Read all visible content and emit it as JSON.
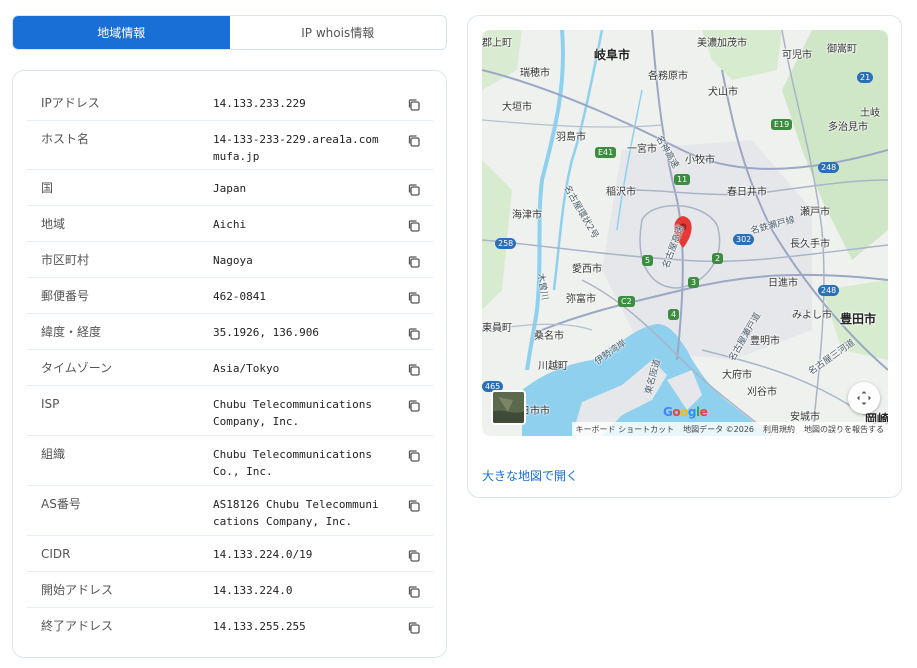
{
  "tabs": [
    {
      "label": "地域情報",
      "active": true
    },
    {
      "label": "IP whois情報",
      "active": false
    }
  ],
  "info_rows": [
    {
      "label": "IPアドレス",
      "value": "14.133.233.229"
    },
    {
      "label": "ホスト名",
      "value": "14-133-233-229.area1a.commufa.jp"
    },
    {
      "label": "国",
      "value": "Japan"
    },
    {
      "label": "地域",
      "value": "Aichi"
    },
    {
      "label": "市区町村",
      "value": "Nagoya"
    },
    {
      "label": "郵便番号",
      "value": "462-0841"
    },
    {
      "label": "緯度・経度",
      "value": "35.1926, 136.906"
    },
    {
      "label": "タイムゾーン",
      "value": "Asia/Tokyo"
    },
    {
      "label": "ISP",
      "value": "Chubu Telecommunications Company, Inc."
    },
    {
      "label": "組織",
      "value": "Chubu Telecommunications Co., Inc."
    },
    {
      "label": "AS番号",
      "value": "AS18126 Chubu Telecommunications Company, Inc."
    },
    {
      "label": "CIDR",
      "value": "14.133.224.0/19"
    },
    {
      "label": "開始アドレス",
      "value": "14.133.224.0"
    },
    {
      "label": "終了アドレス",
      "value": "14.133.255.255"
    }
  ],
  "map": {
    "places": [
      {
        "name": "郡上町",
        "cls": ""
      },
      {
        "name": "岐阜市",
        "cls": "big"
      },
      {
        "name": "美濃加茂市",
        "cls": ""
      },
      {
        "name": "可児市",
        "cls": ""
      },
      {
        "name": "御嵩町",
        "cls": ""
      },
      {
        "name": "瑞穂市",
        "cls": ""
      },
      {
        "name": "各務原市",
        "cls": ""
      },
      {
        "name": "犬山市",
        "cls": ""
      },
      {
        "name": "大垣市",
        "cls": ""
      },
      {
        "name": "土岐",
        "cls": ""
      },
      {
        "name": "多治見市",
        "cls": ""
      },
      {
        "name": "羽島市",
        "cls": ""
      },
      {
        "name": "一宮市",
        "cls": ""
      },
      {
        "name": "小牧市",
        "cls": ""
      },
      {
        "name": "稲沢市",
        "cls": ""
      },
      {
        "name": "春日井市",
        "cls": ""
      },
      {
        "name": "海津市",
        "cls": ""
      },
      {
        "name": "瀬戸市",
        "cls": ""
      },
      {
        "name": "長久手市",
        "cls": ""
      },
      {
        "name": "愛西市",
        "cls": ""
      },
      {
        "name": "日進市",
        "cls": ""
      },
      {
        "name": "弥富市",
        "cls": ""
      },
      {
        "name": "みよし市",
        "cls": ""
      },
      {
        "name": "豊田市",
        "cls": "big"
      },
      {
        "name": "東員町",
        "cls": ""
      },
      {
        "name": "桑名市",
        "cls": ""
      },
      {
        "name": "豊明市",
        "cls": ""
      },
      {
        "name": "川越町",
        "cls": ""
      },
      {
        "name": "大府市",
        "cls": ""
      },
      {
        "name": "刈谷市",
        "cls": ""
      },
      {
        "name": "安城市",
        "cls": ""
      },
      {
        "name": "岡崎",
        "cls": "big"
      },
      {
        "name": "日市市",
        "cls": ""
      }
    ],
    "roads": [
      {
        "name": "名神高速",
        "rot": "60"
      },
      {
        "name": "名古屋高速",
        "rot": "-70"
      },
      {
        "name": "東名阪道",
        "rot": "-75"
      },
      {
        "name": "名鉄瀬戸線",
        "rot": "-15"
      },
      {
        "name": "伊勢湾岸",
        "rot": "-35"
      },
      {
        "name": "名古屋三河道",
        "rot": "-35"
      },
      {
        "name": "木曽川",
        "rot": "80"
      },
      {
        "name": "名古屋環状2号",
        "rot": "60"
      },
      {
        "name": "名古屋瀬戸道",
        "rot": "-60"
      }
    ],
    "shields": [
      {
        "label": "21",
        "cls": "b"
      },
      {
        "label": "E19",
        "cls": "g"
      },
      {
        "label": "E41",
        "cls": "g"
      },
      {
        "label": "11",
        "cls": "g"
      },
      {
        "label": "248",
        "cls": "b"
      },
      {
        "label": "258",
        "cls": "b"
      },
      {
        "label": "302",
        "cls": "b"
      },
      {
        "label": "5",
        "cls": "g"
      },
      {
        "label": "2",
        "cls": "g"
      },
      {
        "label": "3",
        "cls": "g"
      },
      {
        "label": "C2",
        "cls": "g"
      },
      {
        "label": "4",
        "cls": "g"
      },
      {
        "label": "248",
        "cls": "b"
      },
      {
        "label": "465",
        "cls": "b"
      }
    ],
    "google_logo": "Google",
    "attribution": [
      "キーボード ショートカット",
      "地図データ ©2026",
      "利用規約",
      "地図の誤りを報告する"
    ],
    "open_link": "大きな地図で開く",
    "colors": {
      "accent": "#1a6fd6",
      "water": "#8fd0ef",
      "park": "#cfe7c7",
      "marker": "#e53935"
    }
  }
}
